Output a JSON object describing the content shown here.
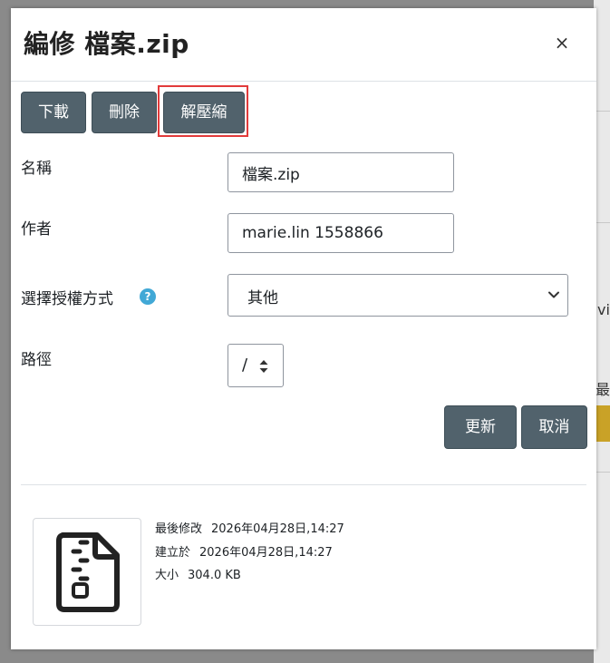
{
  "dialog": {
    "title": "編修 檔案.zip",
    "close_symbol": "×"
  },
  "actions": {
    "download_label": "下載",
    "delete_label": "刪除",
    "unzip_label": "解壓縮"
  },
  "form": {
    "name_label": "名稱",
    "name_value": "檔案.zip",
    "author_label": "作者",
    "author_value": "marie.lin 1558866",
    "license_label": "選擇授權方式",
    "license_help_symbol": "?",
    "license_value": "其他",
    "path_label": "路徑",
    "path_value": "/",
    "update_label": "更新",
    "cancel_label": "取消"
  },
  "file_info": {
    "modified_label": "最後修改",
    "modified_value": "2026年04月28日,14:27",
    "created_label": "建立於",
    "created_value": "2026年04月28日,14:27",
    "size_label": "大小",
    "size_value": "304.0 KB",
    "icon": "zip-file-icon"
  },
  "background": {
    "fragment_vi": "vi",
    "fragment_most": "最"
  },
  "colors": {
    "button_bg": "#51626c",
    "highlight": "#e23b3b",
    "help_icon": "#41a8d6"
  }
}
